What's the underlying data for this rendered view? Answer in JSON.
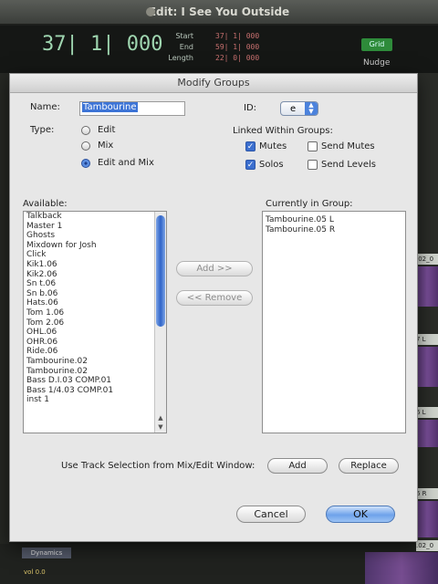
{
  "window": {
    "title": "Edit: I See You Outside"
  },
  "transport": {
    "main_counter": "37| 1| 000",
    "start_label": "Start",
    "end_label": "End",
    "length_label": "Length",
    "start_value": "37| 1| 000",
    "end_value": "59| 1| 000",
    "length_value": "22| 0| 000",
    "grid_button": "Grid",
    "nudge_label": "Nudge"
  },
  "bg_tracks": {
    "tag1": ".02_0",
    "tag2": "7 L",
    "tag3": "6 L",
    "tag4": "6 R",
    "tag5": ".02_0",
    "insert": "Dynamics",
    "vol_label": "vol",
    "vol_value": "0.0"
  },
  "dialog": {
    "title": "Modify Groups",
    "name_label": "Name:",
    "name_value": "Tambourine",
    "id_label": "ID:",
    "id_value": "e",
    "type_label": "Type:",
    "type_options": [
      "Edit",
      "Mix",
      "Edit and Mix"
    ],
    "type_selected": "Edit and Mix",
    "linked_label": "Linked Within Groups:",
    "mutes_label": "Mutes",
    "mutes_checked": true,
    "send_mutes_label": "Send Mutes",
    "send_mutes_checked": false,
    "solos_label": "Solos",
    "solos_checked": true,
    "send_levels_label": "Send Levels",
    "send_levels_checked": false,
    "available_label": "Available:",
    "available_items": [
      "Talkback",
      "Master 1",
      "Ghosts",
      "Mixdown for Josh",
      "Click",
      "Kik1.06",
      "Kik2.06",
      "Sn t.06",
      "Sn b.06",
      "Hats.06",
      "Tom 1.06",
      "Tom 2.06",
      "OHL.06",
      "OHR.06",
      "Ride.06",
      "Tambourine.02",
      "Tambourine.02",
      "Bass D.I.03 COMP.01",
      "Bass 1/4.03 COMP.01",
      "inst 1"
    ],
    "in_group_label": "Currently in Group:",
    "in_group_items": [
      "Tambourine.05 L",
      "Tambourine.05 R"
    ],
    "add_button": "Add >>",
    "remove_button": "<< Remove",
    "selection_label": "Use Track Selection from Mix/Edit Window:",
    "sel_add_button": "Add",
    "sel_replace_button": "Replace",
    "cancel_button": "Cancel",
    "ok_button": "OK"
  }
}
